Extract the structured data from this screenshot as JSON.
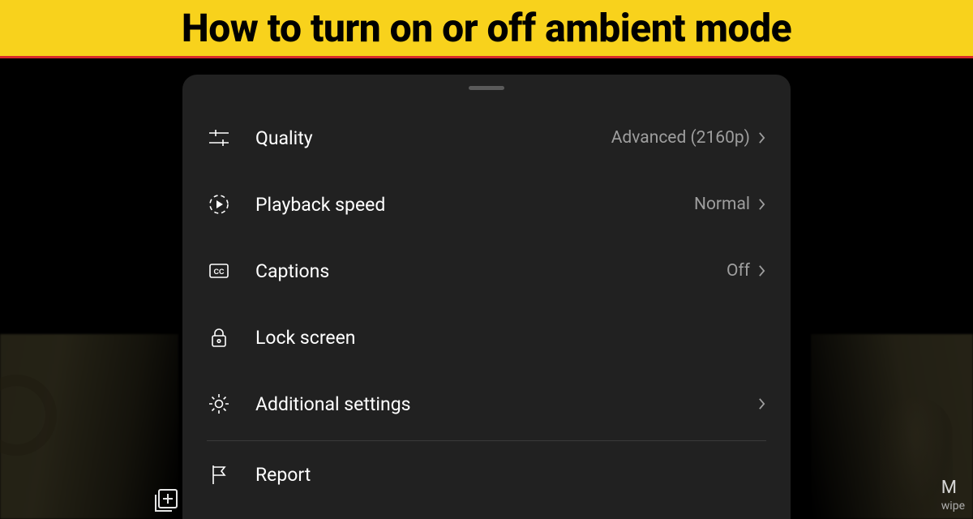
{
  "banner": {
    "title": "How to turn on or off ambient mode"
  },
  "menu": {
    "items": [
      {
        "label": "Quality",
        "value": "Advanced (2160p)",
        "chevron": true,
        "icon": "sliders"
      },
      {
        "label": "Playback speed",
        "value": "Normal",
        "chevron": true,
        "icon": "playback-speed"
      },
      {
        "label": "Captions",
        "value": "Off",
        "chevron": true,
        "icon": "cc"
      },
      {
        "label": "Lock screen",
        "value": "",
        "chevron": false,
        "icon": "lock"
      },
      {
        "label": "Additional settings",
        "value": "",
        "chevron": true,
        "icon": "gear"
      },
      {
        "label": "Report",
        "value": "",
        "chevron": false,
        "icon": "flag"
      }
    ]
  },
  "background": {
    "right_caption_top": "M",
    "right_caption_sub": "wipe"
  }
}
